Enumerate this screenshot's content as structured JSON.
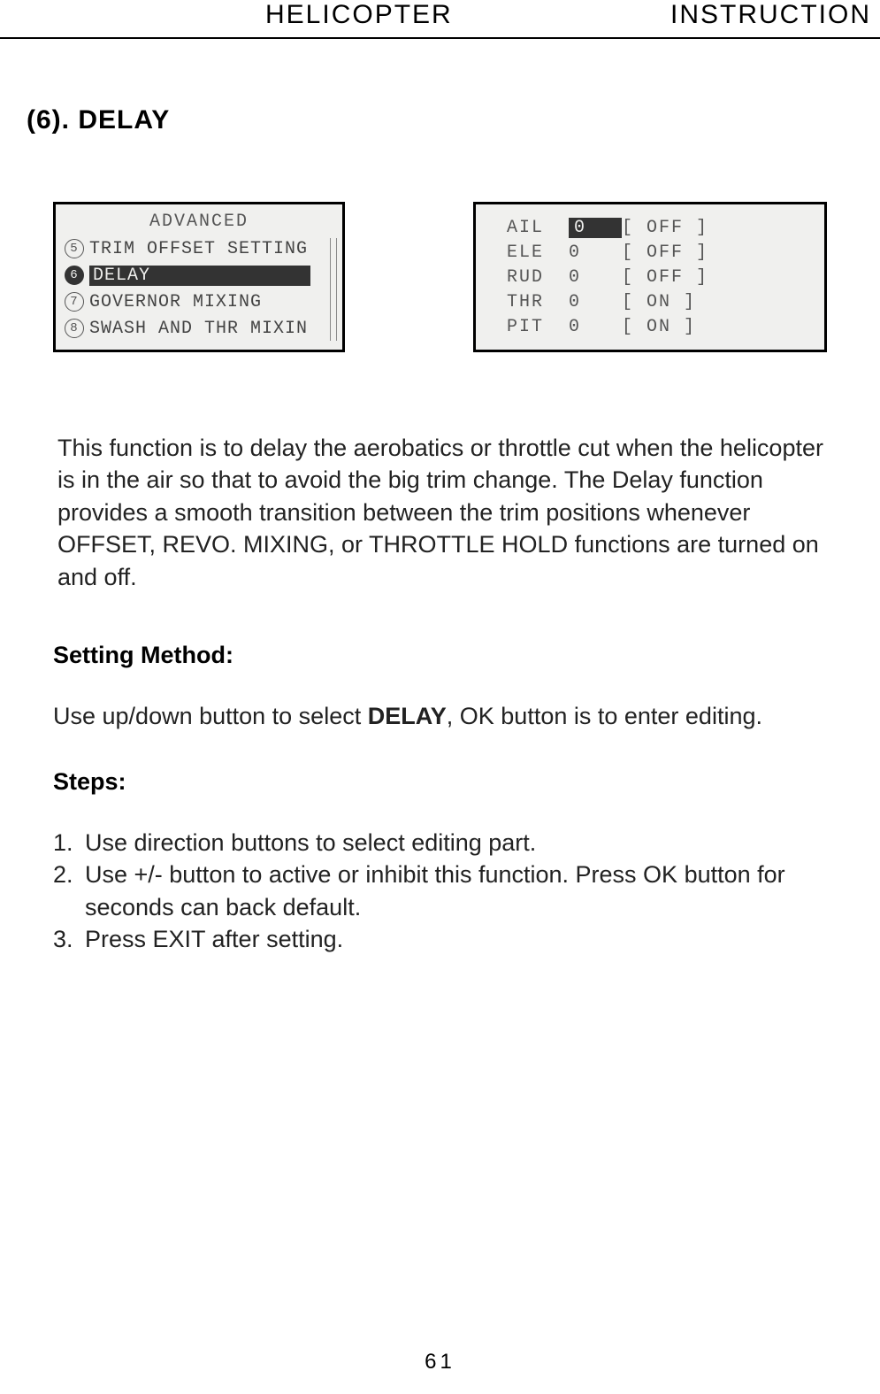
{
  "header": {
    "left": "HELICOPTER",
    "right": "INSTRUCTION"
  },
  "section_title": "(6). DELAY",
  "lcd_left": {
    "title": "ADVANCED",
    "items": [
      {
        "num": "5",
        "label": "TRIM OFFSET SETTING",
        "selected": false
      },
      {
        "num": "6",
        "label": "DELAY",
        "selected": true
      },
      {
        "num": "7",
        "label": "GOVERNOR MIXING",
        "selected": false
      },
      {
        "num": "8",
        "label": "SWASH AND THR MIXIN",
        "selected": false
      }
    ]
  },
  "lcd_right": {
    "rows": [
      {
        "label": "AIL",
        "value": "0",
        "state": "[ OFF ]",
        "highlight": true
      },
      {
        "label": "ELE",
        "value": "0",
        "state": "[ OFF ]",
        "highlight": false
      },
      {
        "label": "RUD",
        "value": "0",
        "state": "[ OFF ]",
        "highlight": false
      },
      {
        "label": "THR",
        "value": "0",
        "state": "[ ON ]",
        "highlight": false
      },
      {
        "label": "PIT",
        "value": "0",
        "state": "[ ON ]",
        "highlight": false
      }
    ]
  },
  "description": "This function is to delay the aerobatics or throttle cut when the helicopter is in the air so that to avoid the big trim change. The Delay function provides a smooth transition between the trim positions whenever OFFSET, REVO. MIXING, or THROTTLE HOLD functions are turned on and off.",
  "setting_method_heading": "Setting Method:",
  "setting_method_text_pre": "Use up/down button to select ",
  "setting_method_bold": "DELAY",
  "setting_method_text_post": ", OK button is to enter editing.",
  "steps_heading": "Steps:",
  "steps": [
    {
      "num": "1.",
      "text": "Use direction buttons to select editing part."
    },
    {
      "num": "2.",
      "text": "Use +/- button to active or inhibit this function. Press OK button for seconds can back default."
    },
    {
      "num": "3.",
      "text": "Press EXIT after setting."
    }
  ],
  "page_number": "61"
}
